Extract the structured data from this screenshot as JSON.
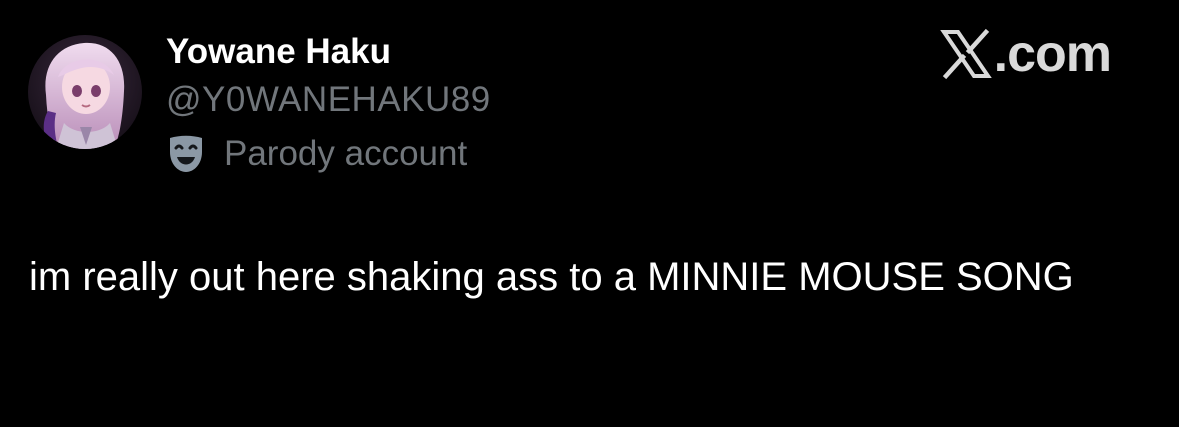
{
  "tweet": {
    "author": {
      "display_name": "Yowane Haku",
      "handle": "@Y0WANEHAKU89",
      "label": "Parody account",
      "label_icon": "theater-mask-icon",
      "avatar": "avatar-image"
    },
    "text": "im really out here shaking ass to a MINNIE MOUSE SONG"
  },
  "brand": {
    "text": ".com",
    "icon": "x-logo-icon"
  },
  "colors": {
    "background": "#000000",
    "primary_text": "#ffffff",
    "secondary_text": "#71767b",
    "brand": "#d9d9d9",
    "mask_icon": "#8b98a5"
  }
}
